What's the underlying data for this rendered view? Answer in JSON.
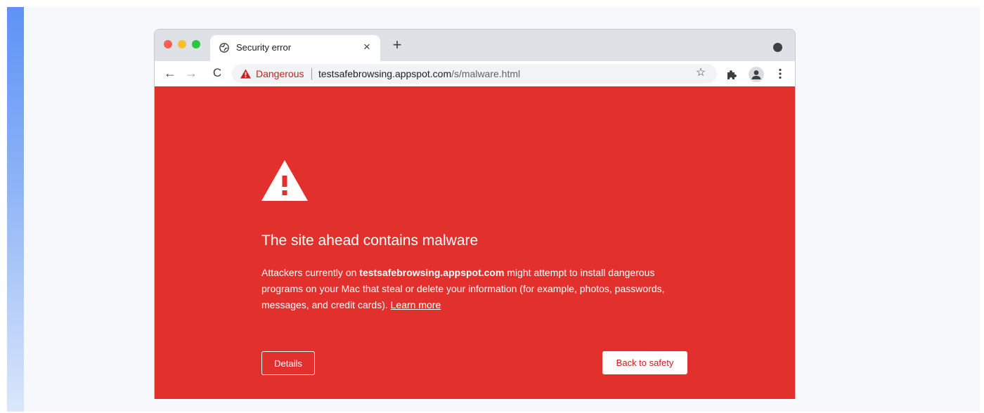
{
  "colors": {
    "page_background": "#f6f8fb",
    "accent_bar": "#5c93f5",
    "interstitial_red": "#e2312d",
    "danger_text": "#c5221f",
    "tabstrip": "#dee1e6"
  },
  "window_controls": {
    "close_icon": "red-traffic-light",
    "minimize_icon": "yellow-traffic-light",
    "zoom_icon": "green-traffic-light"
  },
  "tab": {
    "favicon": "globe-icon",
    "title": "Security error",
    "close_label": "×"
  },
  "tabstrip": {
    "new_tab_label": "+",
    "profile_icon": "chrome-profile-dot-icon"
  },
  "toolbar": {
    "back_icon": "←",
    "forward_icon": "→",
    "reload_icon": "C"
  },
  "omnibox": {
    "security_icon": "warning-triangle-icon",
    "security_label": "Dangerous",
    "url_host": "testsafebrowsing.appspot.com",
    "url_path": "/s/malware.html",
    "bookmark_icon": "☆"
  },
  "interstitial": {
    "icon": "warning-triangle-icon",
    "heading": "The site ahead contains malware",
    "body_prefix": "Attackers currently on ",
    "body_site": "testsafebrowsing.appspot.com",
    "body_suffix": " might attempt to install dangerous programs on your Mac that steal or delete your information (for example, photos, passwords, messages, and credit cards). ",
    "learn_more": "Learn more",
    "details_button": "Details",
    "back_button": "Back to safety"
  }
}
